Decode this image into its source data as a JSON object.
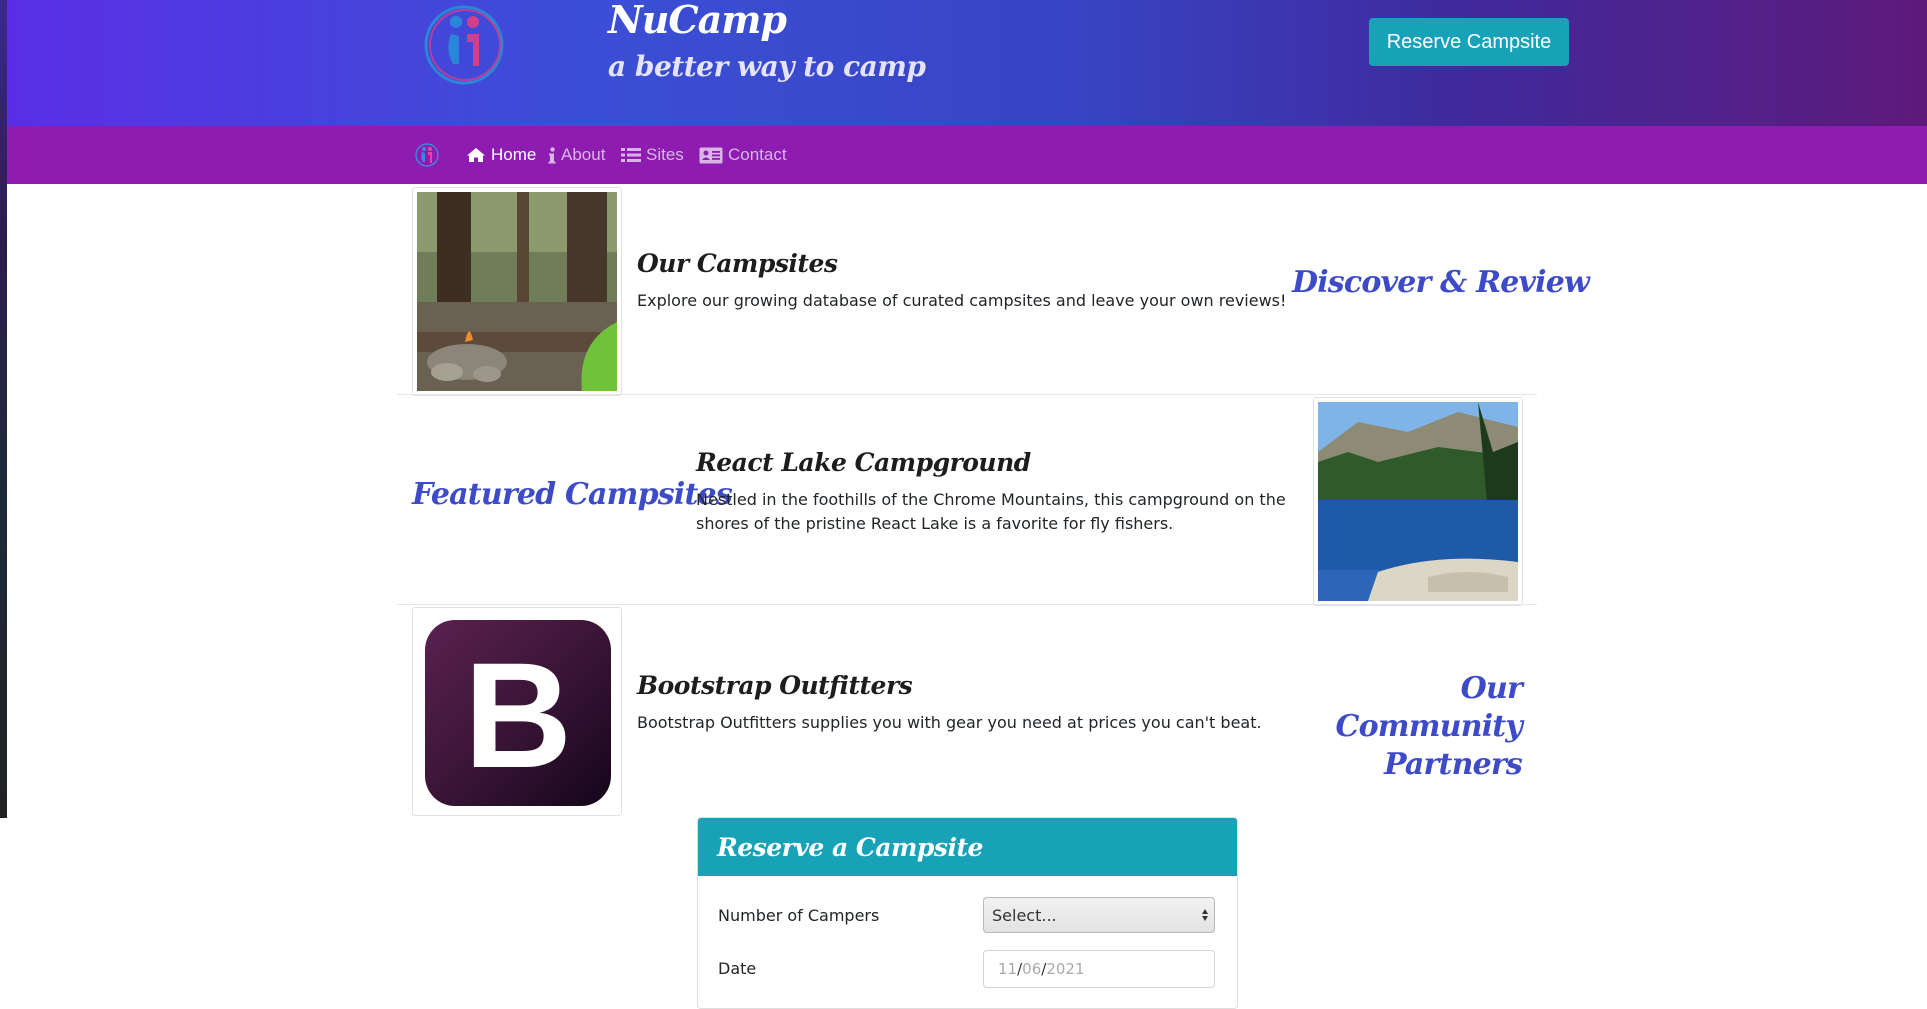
{
  "header": {
    "brand_title": "NuCamp",
    "brand_subtitle": "a better way to camp",
    "reserve_button": "Reserve Campsite"
  },
  "nav": {
    "items": [
      {
        "label": "Home",
        "icon": "home-icon",
        "active": true
      },
      {
        "label": "About",
        "icon": "info-icon",
        "active": false
      },
      {
        "label": "Sites",
        "icon": "list-icon",
        "active": false
      },
      {
        "label": "Contact",
        "icon": "address-card-icon",
        "active": false
      }
    ]
  },
  "rows": [
    {
      "title": "Our Campsites",
      "text": "Explore our growing database of curated campsites and leave your own reviews!",
      "side_heading": "Discover & Review",
      "image": "campfire-forest-photo"
    },
    {
      "title": "React Lake Campground",
      "text_line1": "Nestled in the foothills of the Chrome Mountains, this campground on the",
      "text_line2": "shores of the pristine React Lake is a favorite for fly fishers.",
      "side_heading": "Featured Campsites",
      "image": "mountain-lake-photo"
    },
    {
      "title": "Bootstrap Outfitters",
      "text": "Bootstrap Outfitters supplies you with gear you need at prices you can't beat.",
      "side_heading_line1": "Our Community",
      "side_heading_line2": "Partners",
      "image": "bootstrap-logo",
      "logo_letter": "B"
    }
  ],
  "reserve_form": {
    "title": "Reserve a Campsite",
    "campers_label": "Number of Campers",
    "campers_value": "Select...",
    "date_label": "Date",
    "date_month": "11",
    "date_day": "06",
    "date_year": "2021",
    "date_separator": "/"
  },
  "colors": {
    "navbar": "#8e1cb0",
    "accent": "#17a2b8",
    "heading_blue": "#3d4bc9"
  }
}
